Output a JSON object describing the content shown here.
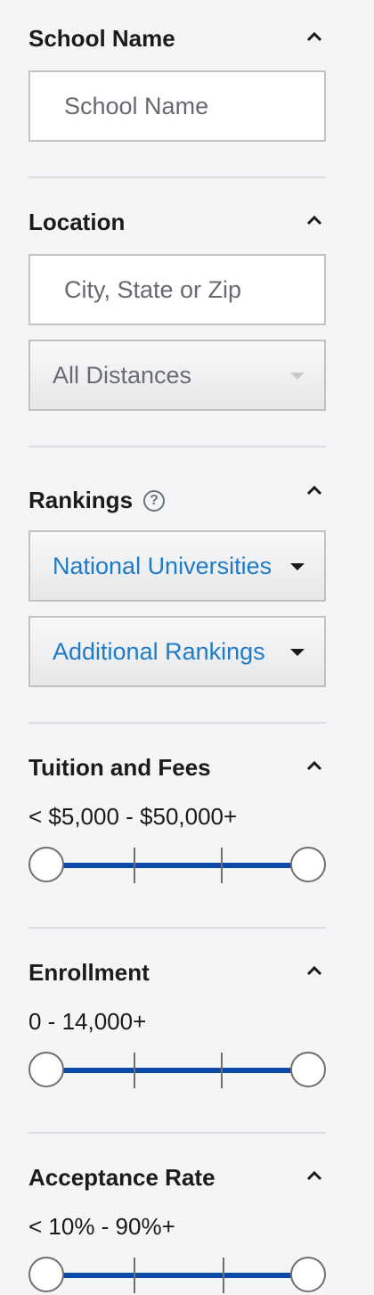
{
  "school_name": {
    "title": "School Name",
    "input_placeholder": "School Name"
  },
  "location": {
    "title": "Location",
    "input_placeholder": "City, State or Zip",
    "distance_select": "All Distances"
  },
  "rankings": {
    "title": "Rankings",
    "help_glyph": "?",
    "primary_select": "National Universities",
    "additional_select": "Additional Rankings"
  },
  "tuition": {
    "title": "Tuition and Fees",
    "range_text": "< $5,000 - $50,000+",
    "slider_min_fraction": 0,
    "slider_max_fraction": 1
  },
  "enrollment": {
    "title": "Enrollment",
    "range_text": "0 - 14,000+",
    "slider_min_fraction": 0,
    "slider_max_fraction": 1
  },
  "acceptance_rate": {
    "title": "Acceptance Rate",
    "range_text": "< 10% - 90%+",
    "slider_min_fraction": 0,
    "slider_max_fraction": 1
  },
  "colors": {
    "link_blue": "#1e7bc8",
    "slider_blue": "#0d4aa8",
    "background": "#f4f5f7"
  },
  "icons": {
    "collapse": "chevron-up-icon",
    "dropdown": "caret-down-icon",
    "help": "question-circle-icon"
  }
}
